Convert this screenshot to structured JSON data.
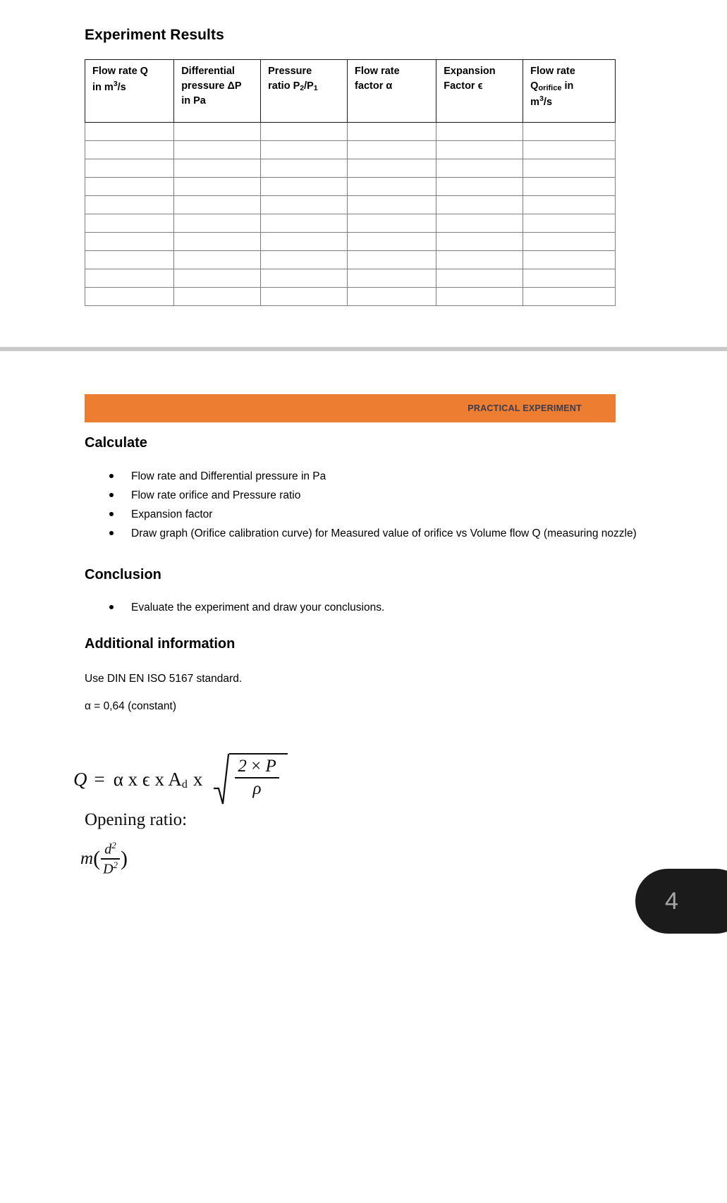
{
  "page_top": {
    "heading": "Experiment Results",
    "table": {
      "columns": [
        {
          "line1": "Flow rate Q",
          "line2": "in m3/s",
          "id": "flow-rate-q"
        },
        {
          "line1": "Differential",
          "line2": "pressure ΔP",
          "line3": "in Pa",
          "id": "differential-pressure"
        },
        {
          "line1": "Pressure",
          "line2": "ratio P2/P1",
          "id": "pressure-ratio"
        },
        {
          "line1": "Flow rate",
          "line2": "factor α",
          "id": "flow-rate-factor"
        },
        {
          "line1": "Expansion",
          "line2": "Factor ϵ",
          "id": "expansion-factor"
        },
        {
          "line1": "Flow rate",
          "line2": "Qorifice in",
          "line3": "m3/s",
          "id": "flow-rate-orifice"
        }
      ],
      "row_count": 10,
      "rows": [
        [
          "",
          "",
          "",
          "",
          "",
          ""
        ],
        [
          "",
          "",
          "",
          "",
          "",
          ""
        ],
        [
          "",
          "",
          "",
          "",
          "",
          ""
        ],
        [
          "",
          "",
          "",
          "",
          "",
          ""
        ],
        [
          "",
          "",
          "",
          "",
          "",
          ""
        ],
        [
          "",
          "",
          "",
          "",
          "",
          ""
        ],
        [
          "",
          "",
          "",
          "",
          "",
          ""
        ],
        [
          "",
          "",
          "",
          "",
          "",
          ""
        ],
        [
          "",
          "",
          "",
          "",
          "",
          ""
        ],
        [
          "",
          "",
          "",
          "",
          "",
          ""
        ]
      ]
    }
  },
  "page_bottom": {
    "banner": {
      "label": "PRACTICAL EXPERIMENT",
      "background_color": "#ED7D31",
      "text_color": "#3b3b4f"
    },
    "calculate": {
      "heading": "Calculate",
      "items": [
        "Flow rate and Differential pressure in Pa",
        "Flow rate orifice and Pressure ratio",
        "Expansion factor",
        "Draw graph (Orifice calibration curve) for Measured value of orifice vs Volume flow Q (measuring nozzle)"
      ]
    },
    "conclusion": {
      "heading": "Conclusion",
      "items": [
        "Evaluate the experiment and draw your conclusions."
      ]
    },
    "additional": {
      "heading": "Additional information",
      "standard_line": "Use DIN EN ISO 5167 standard.",
      "alpha_line": "α = 0,64 (constant)"
    },
    "formula_main": {
      "lhs": "Q",
      "equals": "=",
      "terms": "α x ϵ x A",
      "subscript_d": "d",
      "multiplier": "x",
      "numerator_left": "2",
      "numerator_op": "×",
      "numerator_right": "P",
      "denominator": "ρ"
    },
    "opening_ratio": {
      "label": "Opening ratio:",
      "symbol": "m",
      "open_paren": "(",
      "numerator": "d",
      "numerator_exp": "2",
      "denominator": "D",
      "denominator_exp": "2",
      "close_paren": ")"
    }
  },
  "overlay": {
    "pill_count": "4",
    "pill_background": "#1b1b1b",
    "pill_text_color": "#a8a8a8"
  }
}
